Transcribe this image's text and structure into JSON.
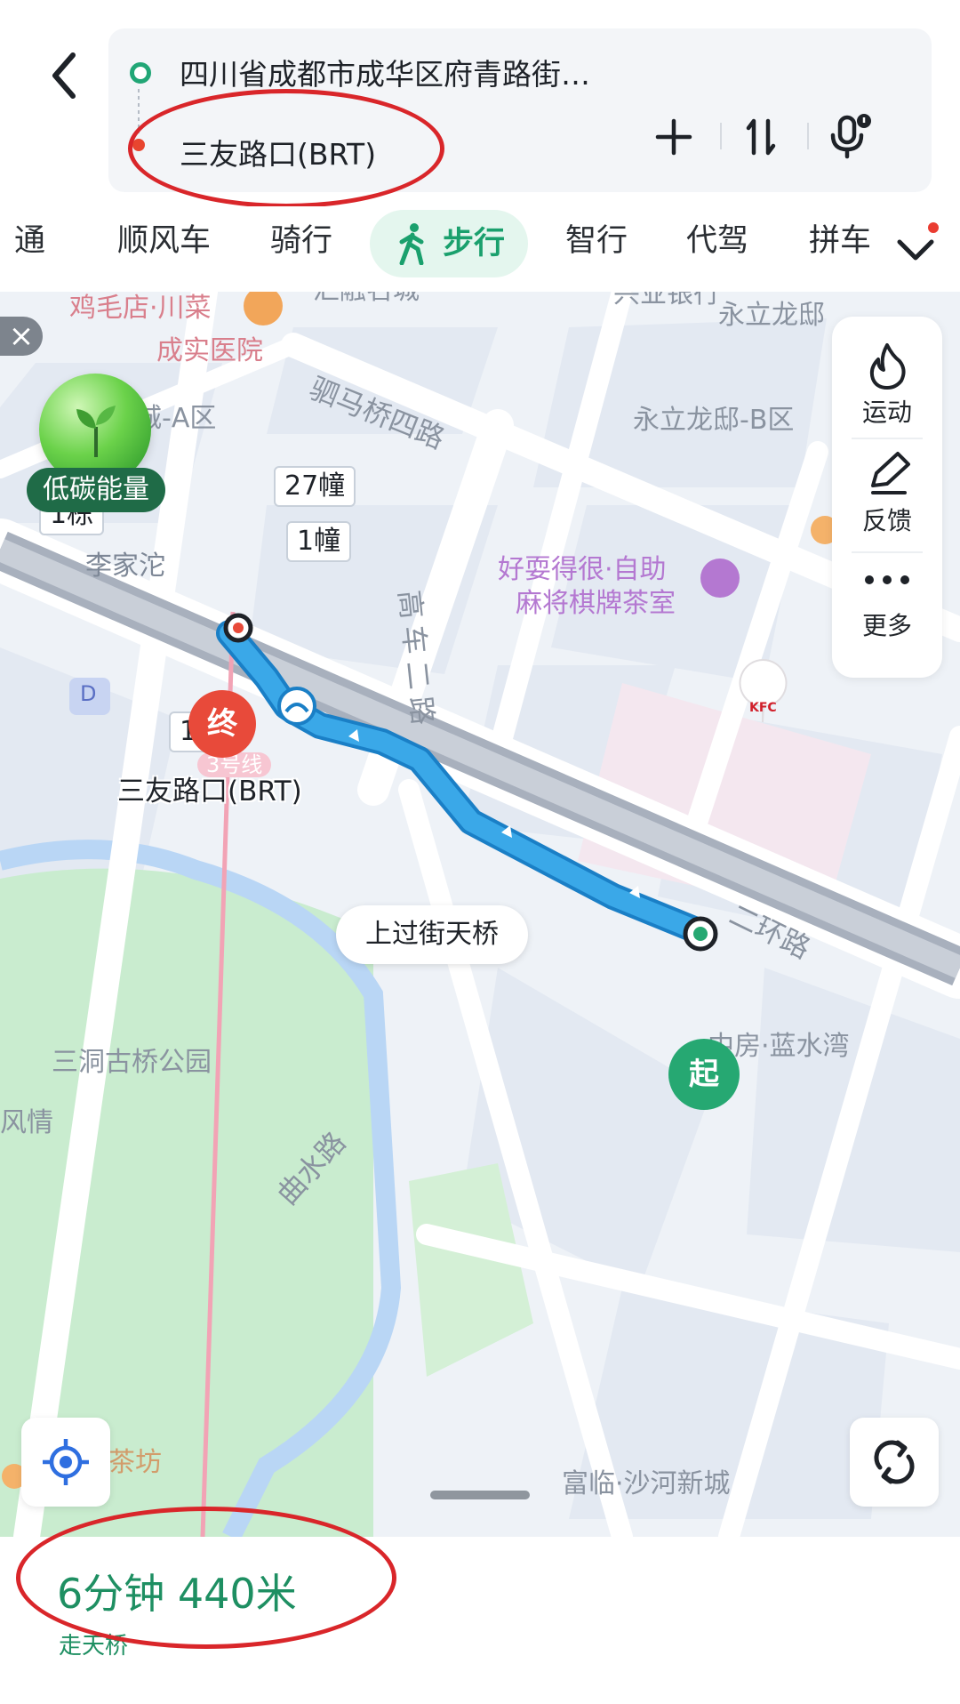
{
  "header": {
    "origin": "四川省成都市成华区府青路街…",
    "destination": "三友路口(BRT)"
  },
  "modes": {
    "items": [
      "通",
      "顺风车",
      "骑行",
      "步行",
      "智行",
      "代驾",
      "拼车"
    ],
    "active": "步行"
  },
  "map": {
    "carbon_label": "低碳能量",
    "close_label": "×",
    "side_panel": {
      "sport": "运动",
      "feedback": "反馈",
      "more": "更多"
    },
    "labels": {
      "bank": "兴业银行",
      "restaurant": "鸡毛店·川菜",
      "hospital": "成实医院",
      "huirong": "汇融名城",
      "yongli": "永立龙邸",
      "road_sima": "驷马桥四路",
      "huirong_a": "汇融名城-A区",
      "yongli_b": "永立龙邸-B区",
      "lijiatuo": "李家沱",
      "haoshua_1": "好耍得很·自助",
      "haoshua_2": "麻将棋牌茶室",
      "road_gaoche": "高车二路",
      "line3": "3号线",
      "road_erhuan": "二环路",
      "zhongfang": "中房·蓝水湾",
      "park": "三洞古桥公园",
      "fengqing": "风情",
      "road_qushui": "曲水路",
      "teahouse": "茶坊",
      "fulin": "富临·沙河新城"
    },
    "building_tags": {
      "b27": "27幢",
      "b1a": "1幢",
      "b1dong": "1栋",
      "b1b": "1幢"
    },
    "end_marker": "终",
    "start_marker": "起",
    "end_label": "三友路口(BRT)",
    "bubble": "上过街天桥",
    "metro_badge": "D"
  },
  "route": {
    "summary": "6分钟 440米",
    "note": "走天桥"
  },
  "colors": {
    "accent": "#1aa06d",
    "route": "#3aa8e8",
    "annotation": "#d9262a",
    "end_marker": "#e84a3a",
    "start_marker": "#26a872"
  }
}
